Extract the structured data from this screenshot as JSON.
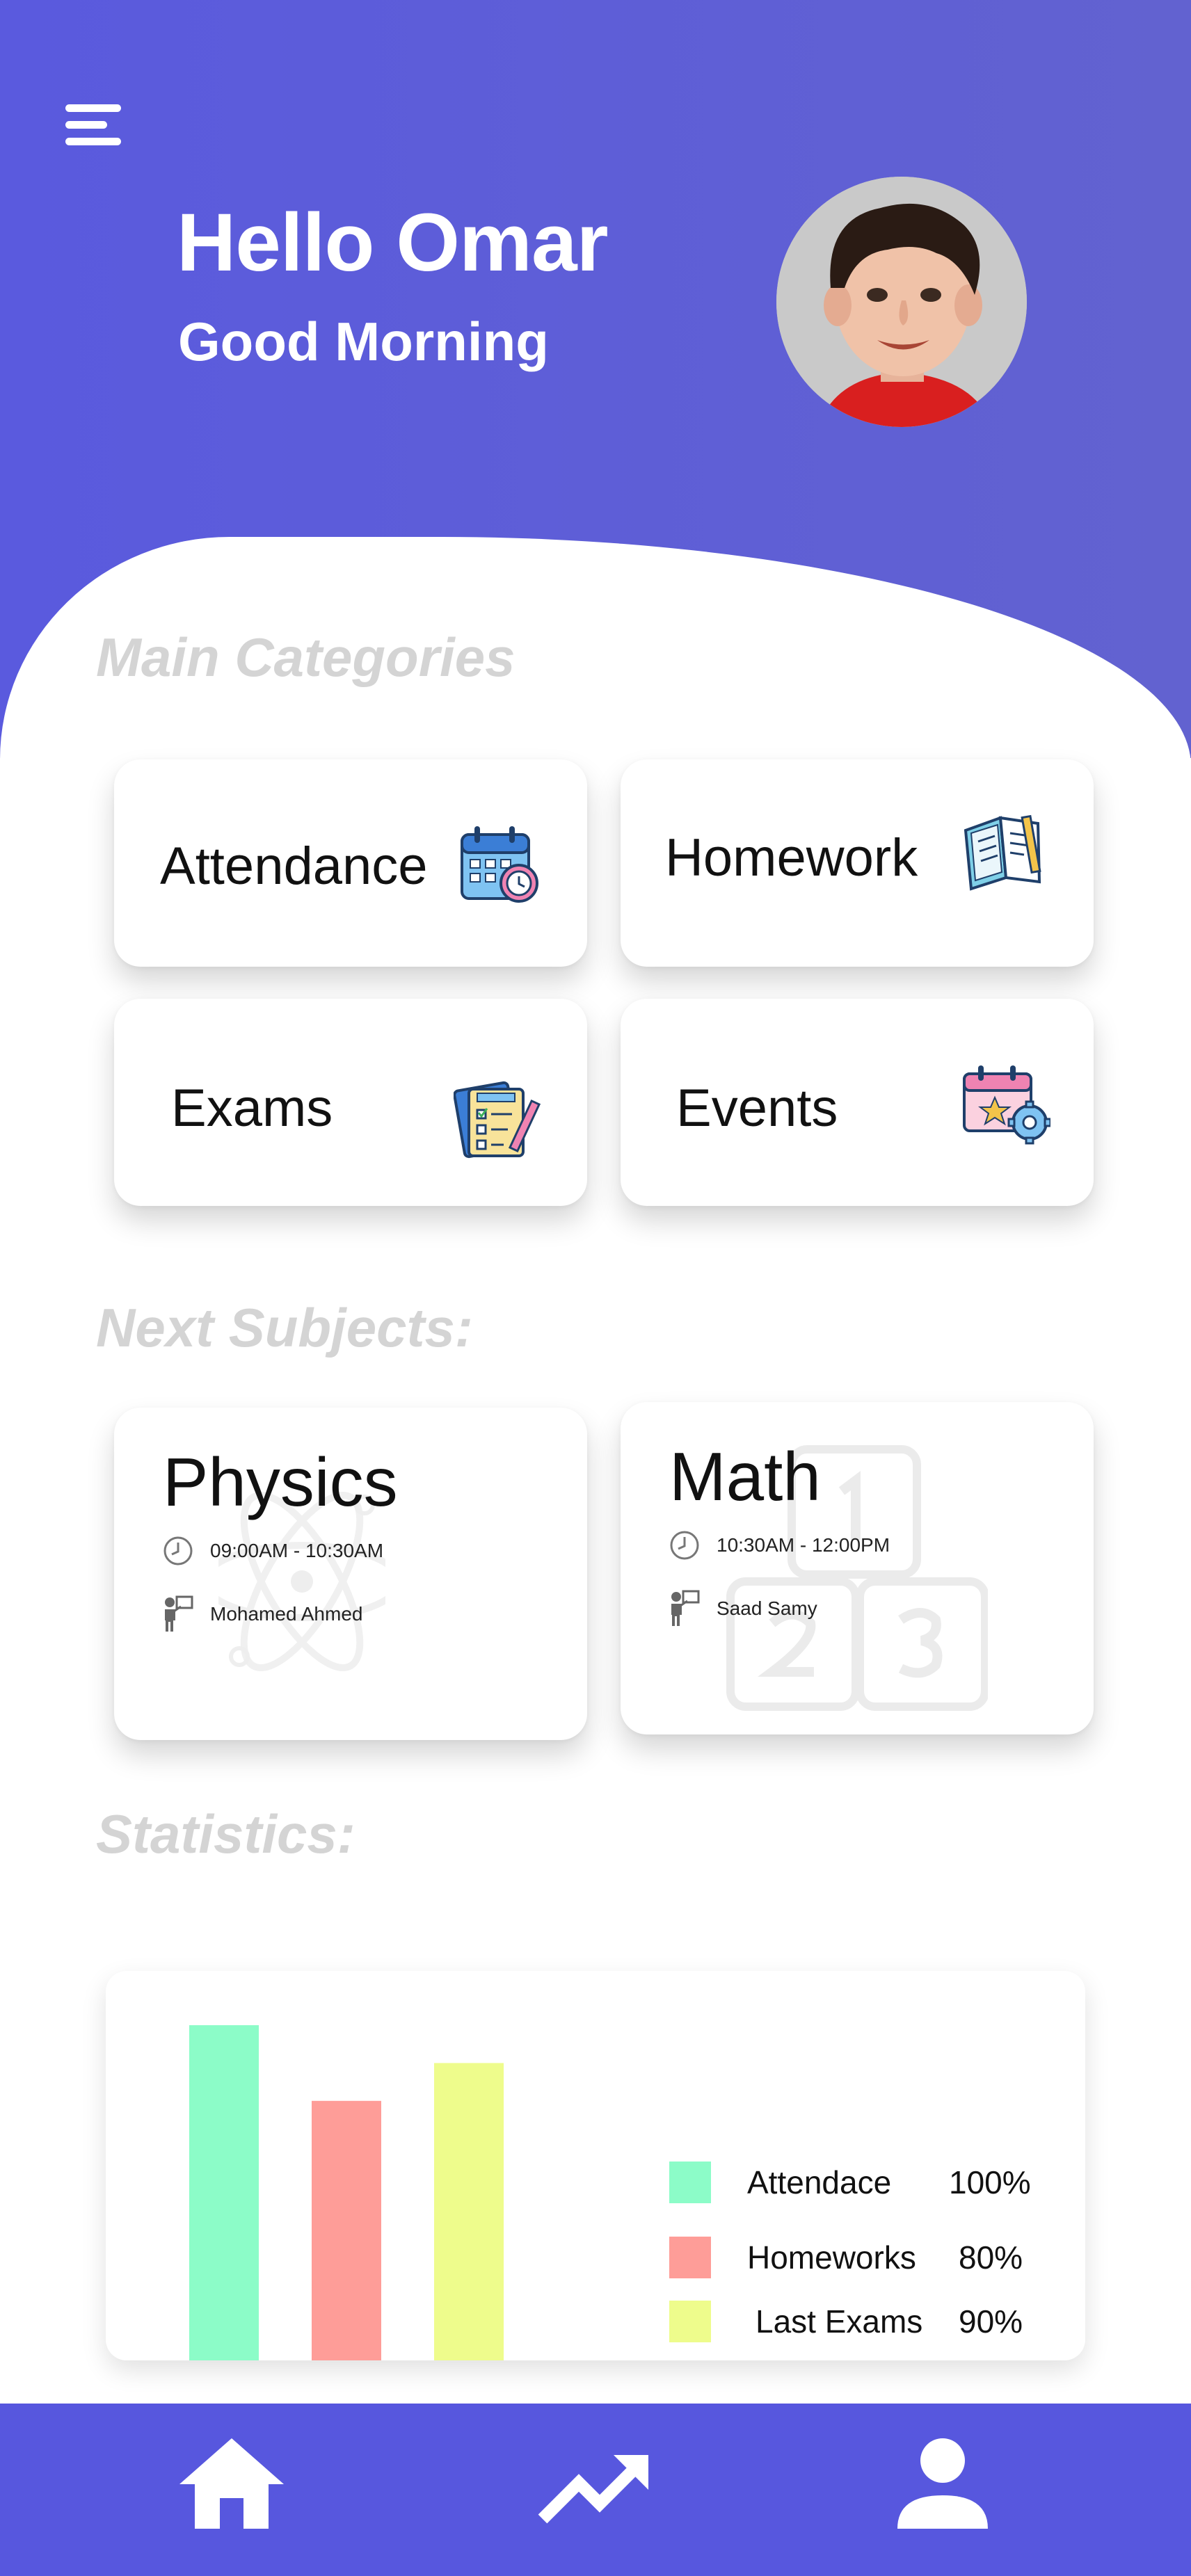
{
  "header": {
    "greeting": "Hello Omar",
    "subgreeting": "Good Morning",
    "brand_color": "#5a5ade"
  },
  "categories": {
    "title": "Main Categories",
    "items": [
      {
        "label": "Attendance",
        "icon": "calendar-clock-icon"
      },
      {
        "label": "Homework",
        "icon": "notebook-pencil-icon"
      },
      {
        "label": "Exams",
        "icon": "checklist-pencil-icon"
      },
      {
        "label": "Events",
        "icon": "calendar-gear-icon"
      }
    ]
  },
  "subjects": {
    "title": "Next Subjects:",
    "items": [
      {
        "name": "Physics",
        "time": "09:00AM - 10:30AM",
        "teacher": "Mohamed Ahmed",
        "bg_icon": "atom-icon"
      },
      {
        "name": "Math",
        "time": "10:30AM - 12:00PM",
        "teacher": "Saad Samy",
        "bg_icon": "number-blocks-icon"
      }
    ]
  },
  "statistics": {
    "title": "Statistics:",
    "legend": [
      {
        "name": "Attendace",
        "value": "100%",
        "color": "#8cfcc8"
      },
      {
        "name": "Homeworks",
        "value": "80%",
        "color": "#fe9d98"
      },
      {
        "name": "Last Exams",
        "value": "90%",
        "color": "#eefc8c"
      }
    ]
  },
  "chart_data": {
    "type": "bar",
    "categories": [
      "Attendace",
      "Homeworks",
      "Last Exams"
    ],
    "values": [
      100,
      80,
      90
    ],
    "ylim": [
      0,
      100
    ],
    "grid": false,
    "legend": "right",
    "colors": [
      "#8cfcc8",
      "#fe9d98",
      "#eefc8c"
    ]
  },
  "nav": {
    "items": [
      {
        "icon": "home-icon"
      },
      {
        "icon": "trending-up-icon"
      },
      {
        "icon": "user-icon"
      }
    ],
    "color": "#5757de"
  }
}
